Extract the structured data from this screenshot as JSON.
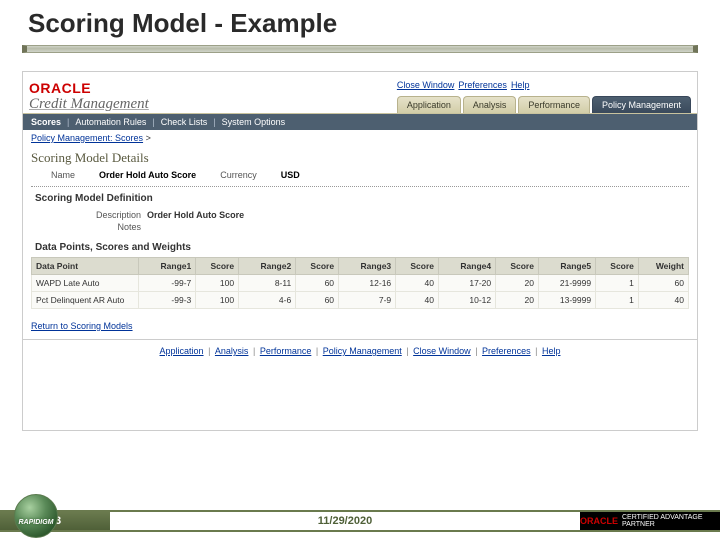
{
  "slide": {
    "title": "Scoring Model - Example",
    "page_number": "13",
    "date": "11/29/2020"
  },
  "logo": {
    "vendor": "ORACLE",
    "app": "Credit Management",
    "footer_brand": "RAPIDIGM",
    "partner_badge": "CERTIFIED ADVANTAGE PARTNER"
  },
  "top_links": {
    "close": "Close Window",
    "prefs": "Preferences",
    "help": "Help"
  },
  "tabs": {
    "application": "Application",
    "analysis": "Analysis",
    "performance": "Performance",
    "policy": "Policy Management"
  },
  "subtabs": {
    "scores": "Scores",
    "automation": "Automation Rules",
    "checklists": "Check Lists",
    "system": "System Options"
  },
  "breadcrumb": {
    "root": "Policy Management: Scores",
    "sep": ">"
  },
  "section": {
    "heading": "Scoring Model Details"
  },
  "details": {
    "name_label": "Name",
    "name_value": "Order Hold Auto Score",
    "currency_label": "Currency",
    "currency_value": "USD"
  },
  "definition": {
    "heading": "Scoring Model Definition",
    "description_label": "Description",
    "description_value": "Order Hold Auto Score",
    "notes_label": "Notes",
    "notes_value": ""
  },
  "data_points": {
    "heading": "Data Points, Scores and Weights",
    "columns": {
      "dp": "Data Point",
      "r1": "Range1",
      "s1": "Score",
      "r2": "Range2",
      "s2": "Score",
      "r3": "Range3",
      "s3": "Score",
      "r4": "Range4",
      "s4": "Score",
      "r5": "Range5",
      "s5": "Score",
      "wt": "Weight"
    },
    "rows": [
      {
        "dp": "WAPD Late Auto",
        "r1": "-99-7",
        "s1": "100",
        "r2": "8-11",
        "s2": "60",
        "r3": "12-16",
        "s3": "40",
        "r4": "17-20",
        "s4": "20",
        "r5": "21-9999",
        "s5": "1",
        "wt": "60"
      },
      {
        "dp": "Pct Delinquent AR Auto",
        "r1": "-99-3",
        "s1": "100",
        "r2": "4-6",
        "s2": "60",
        "r3": "7-9",
        "s3": "40",
        "r4": "10-12",
        "s4": "20",
        "r5": "13-9999",
        "s5": "1",
        "wt": "40"
      }
    ]
  },
  "return_link": "Return to Scoring Models",
  "bottom_nav": {
    "application": "Application",
    "analysis": "Analysis",
    "performance": "Performance",
    "policy": "Policy Management",
    "close": "Close Window",
    "prefs": "Preferences",
    "help": "Help"
  }
}
